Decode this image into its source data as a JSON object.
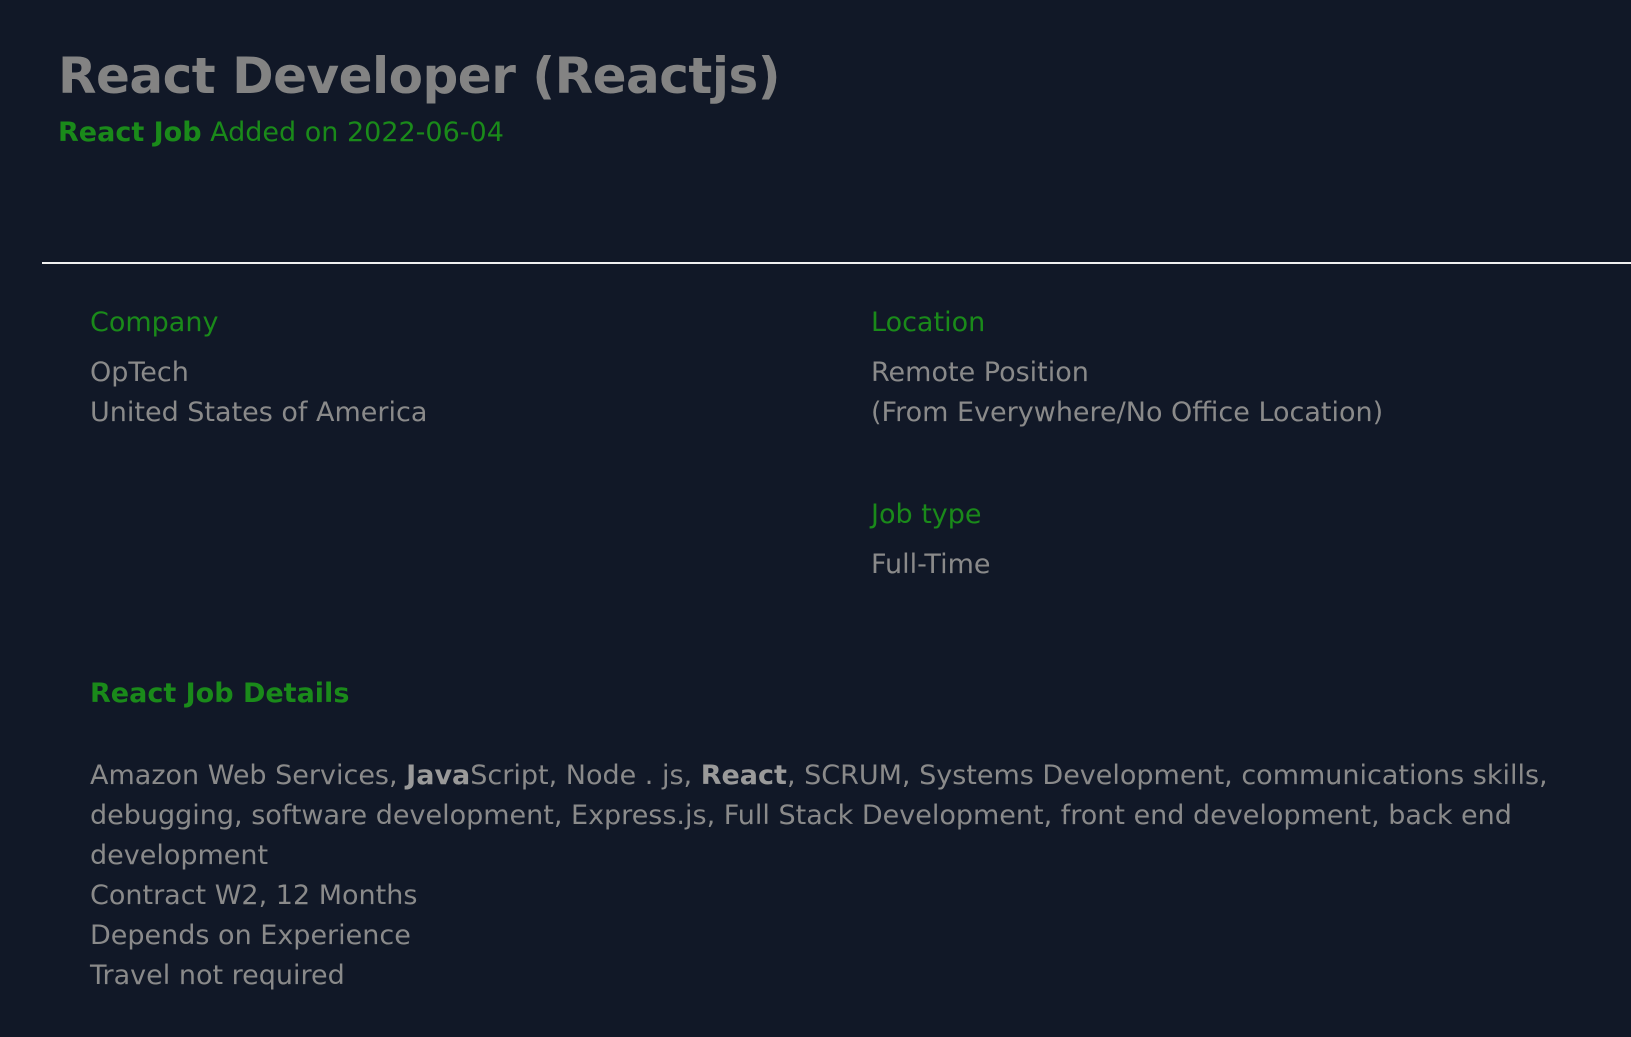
{
  "job": {
    "title": "React Developer (Reactjs)",
    "category": "React Job",
    "added_text": " Added on 2022-06-04"
  },
  "company": {
    "label": "Company",
    "name": "OpTech",
    "country": "United States of America"
  },
  "location": {
    "label": "Location",
    "line1": "Remote Position",
    "line2": "(From Everywhere/No Office Location)"
  },
  "job_type": {
    "label": "Job type",
    "value": "Full-Time"
  },
  "details": {
    "heading": "React Job Details",
    "skills": {
      "part1": "Amazon Web Services, ",
      "bold1": "Java",
      "part2": "Script, Node . js, ",
      "bold2": "React",
      "part3": ", SCRUM, Systems Development, communications skills, debugging, software development, Express.js, Full Stack Development, front end development, back end development"
    },
    "contract": "Contract W2, 12 Months",
    "pay": "Depends on Experience",
    "travel": "Travel not required"
  },
  "colors": {
    "background": "#111827",
    "accent_green": "#1a8a1a",
    "text_gray": "#8a8a8a",
    "divider": "#f0f0f0"
  }
}
